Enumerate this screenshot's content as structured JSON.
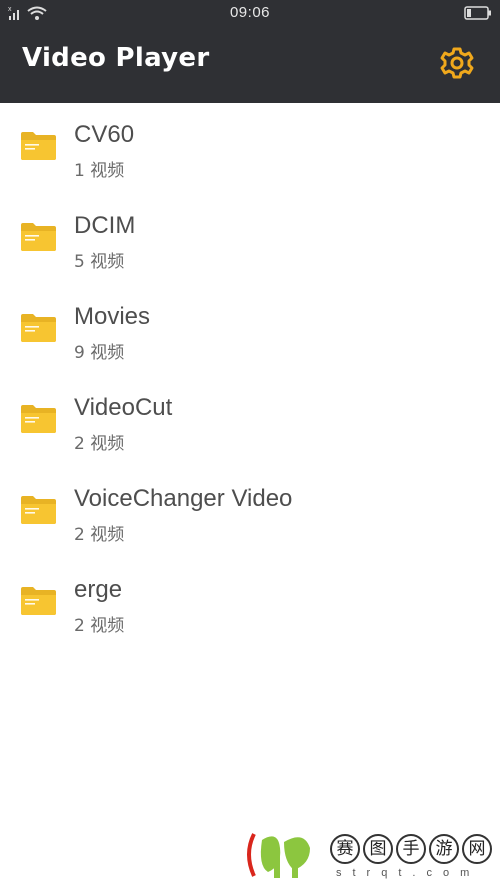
{
  "status_bar": {
    "time": "09:06",
    "signal_icon": "signal-wifi-icon",
    "battery_icon": "battery-icon"
  },
  "header": {
    "title": "Video Player",
    "settings_icon": "gear-icon",
    "accent_color": "#f0a81c",
    "background_color": "#2f3034"
  },
  "folders": [
    {
      "name": "CV60",
      "count": "1 视频"
    },
    {
      "name": "DCIM",
      "count": "5 视频"
    },
    {
      "name": "Movies",
      "count": "9 视频"
    },
    {
      "name": "VideoCut",
      "count": "2 视频"
    },
    {
      "name": "VoiceChanger Video",
      "count": "2 视频"
    },
    {
      "name": "erge",
      "count": "2 视频"
    }
  ],
  "folder_color": "#f7c531",
  "watermark": {
    "chars": [
      "赛",
      "图",
      "手",
      "游",
      "网"
    ],
    "sub": "strqt.com"
  }
}
